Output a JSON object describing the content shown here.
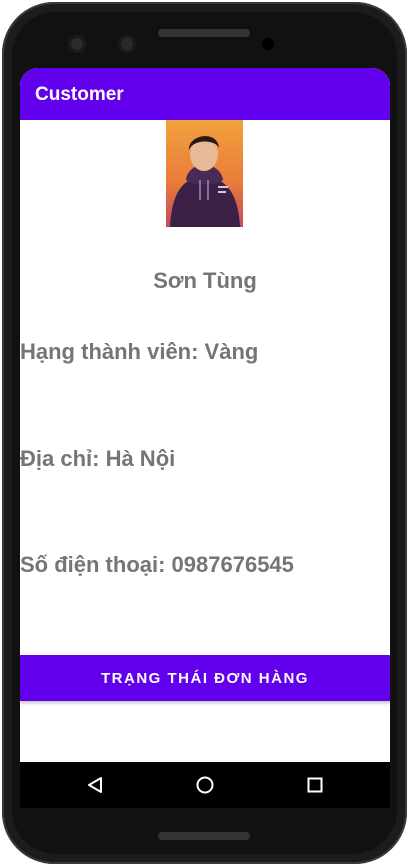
{
  "appbar": {
    "title": "Customer"
  },
  "profile": {
    "name": "Sơn Tùng",
    "membership": "Hạng thành viên: Vàng",
    "address": "Địa chỉ: Hà Nội",
    "phone": "Số điện thoại: 0987676545"
  },
  "actions": {
    "order_status_button": "TRẠNG THÁI ĐƠN HÀNG"
  },
  "colors": {
    "primary": "#6200ee",
    "text_secondary": "#757575",
    "screen_bg": "#ffffff"
  },
  "navigation": {
    "icons": [
      "back-icon",
      "home-icon",
      "recents-icon"
    ]
  }
}
